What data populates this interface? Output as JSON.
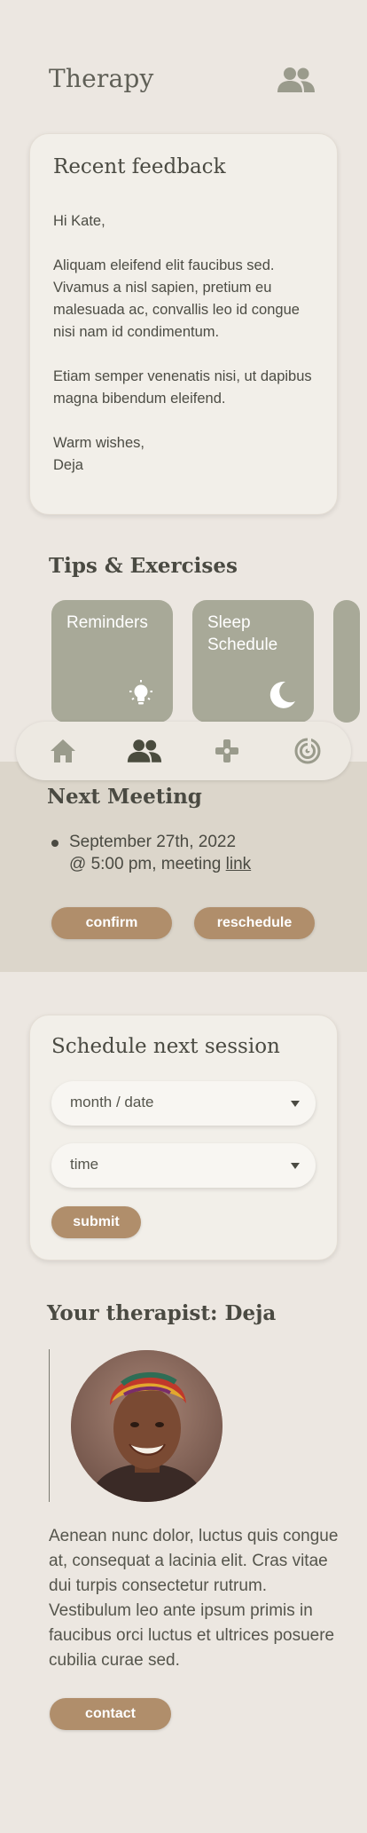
{
  "header": {
    "title": "Therapy",
    "icon": "people-icon"
  },
  "feedback": {
    "title": "Recent feedback",
    "greeting": "Hi Kate,",
    "paragraph1": "Aliquam eleifend elit faucibus sed. Vivamus a nisl sapien, pretium eu malesuada ac, convallis leo id congue nisi nam id condimentum.",
    "paragraph2": "Etiam semper venenatis nisi, ut dapibus magna bibendum eleifend.",
    "closing": "Warm wishes,",
    "signature": "Deja"
  },
  "tips": {
    "title": "Tips & Exercises",
    "items": [
      {
        "label": "Reminders",
        "icon": "lightbulb-icon"
      },
      {
        "label": "Sleep Schedule",
        "icon": "moon-icon"
      }
    ]
  },
  "nav": {
    "items": [
      {
        "name": "home",
        "icon": "home-icon"
      },
      {
        "name": "therapy",
        "icon": "people-icon",
        "active": true
      },
      {
        "name": "games",
        "icon": "gamepad-icon"
      },
      {
        "name": "focus",
        "icon": "target-icon"
      }
    ]
  },
  "next_meeting": {
    "title": "Next Meeting",
    "date_line": "September 27th, 2022",
    "time_line_prefix": "@ 5:00 pm, meeting ",
    "link_text": "link",
    "confirm_label": "confirm",
    "reschedule_label": "reschedule"
  },
  "schedule": {
    "title": "Schedule next session",
    "date_select_value": "month / date",
    "time_select_value": "time",
    "submit_label": "submit"
  },
  "therapist": {
    "title": "Your therapist: Deja",
    "bio": "Aenean nunc dolor, luctus quis congue at, consequat a lacinia elit. Cras vitae dui turpis consectetur rutrum. Vestibulum leo ante ipsum primis in faucibus orci luctus et ultrices posuere cubilia curae sed.",
    "contact_label": "contact"
  },
  "colors": {
    "background": "#ece7e1",
    "card": "#f2efe9",
    "accent": "#b08e6b",
    "tip_card": "#a8a998",
    "section_band": "#dcd6cb",
    "text": "#4a4a42"
  }
}
